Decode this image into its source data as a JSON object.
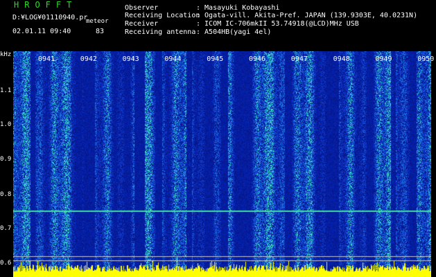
{
  "header": {
    "app_title": "HROFFT",
    "file_path": "D:¥LOG¥01110940.pr",
    "mode_label": "meteor",
    "datetime": "02.01.11 09:40",
    "count": "83",
    "info": [
      {
        "label": "Observer",
        "value": ": Masayuki Kobayashi"
      },
      {
        "label": "Receiving Location",
        "value": ": Ogata-vill. Akita-Pref. JAPAN (139.9303E, 40.0231N)"
      },
      {
        "label": "Receiver",
        "value": ": ICOM IC-706mkII 53.74918(@LCD)MHz USB"
      },
      {
        "label": "Receiving antenna",
        "value": ": A504HB(yagi 4el)"
      }
    ]
  },
  "plot": {
    "y_unit": "kHz",
    "y_ticks": [
      "1.1",
      "1.0",
      "0.9",
      "0.8",
      "0.7",
      "0.6"
    ],
    "x_ticks": [
      "0941",
      "0942",
      "0943",
      "0944",
      "0945",
      "0946",
      "0947",
      "0948",
      "0949",
      "0950"
    ],
    "colors": {
      "background": "#000000",
      "noise_low": "#0a1fb0",
      "noise_mid": "#1e6ae0",
      "noise_high": "#32d2c8",
      "carrier": "#40e0a0",
      "bottom_band": "#ffff00",
      "title_green": "#2fd82f"
    }
  }
}
